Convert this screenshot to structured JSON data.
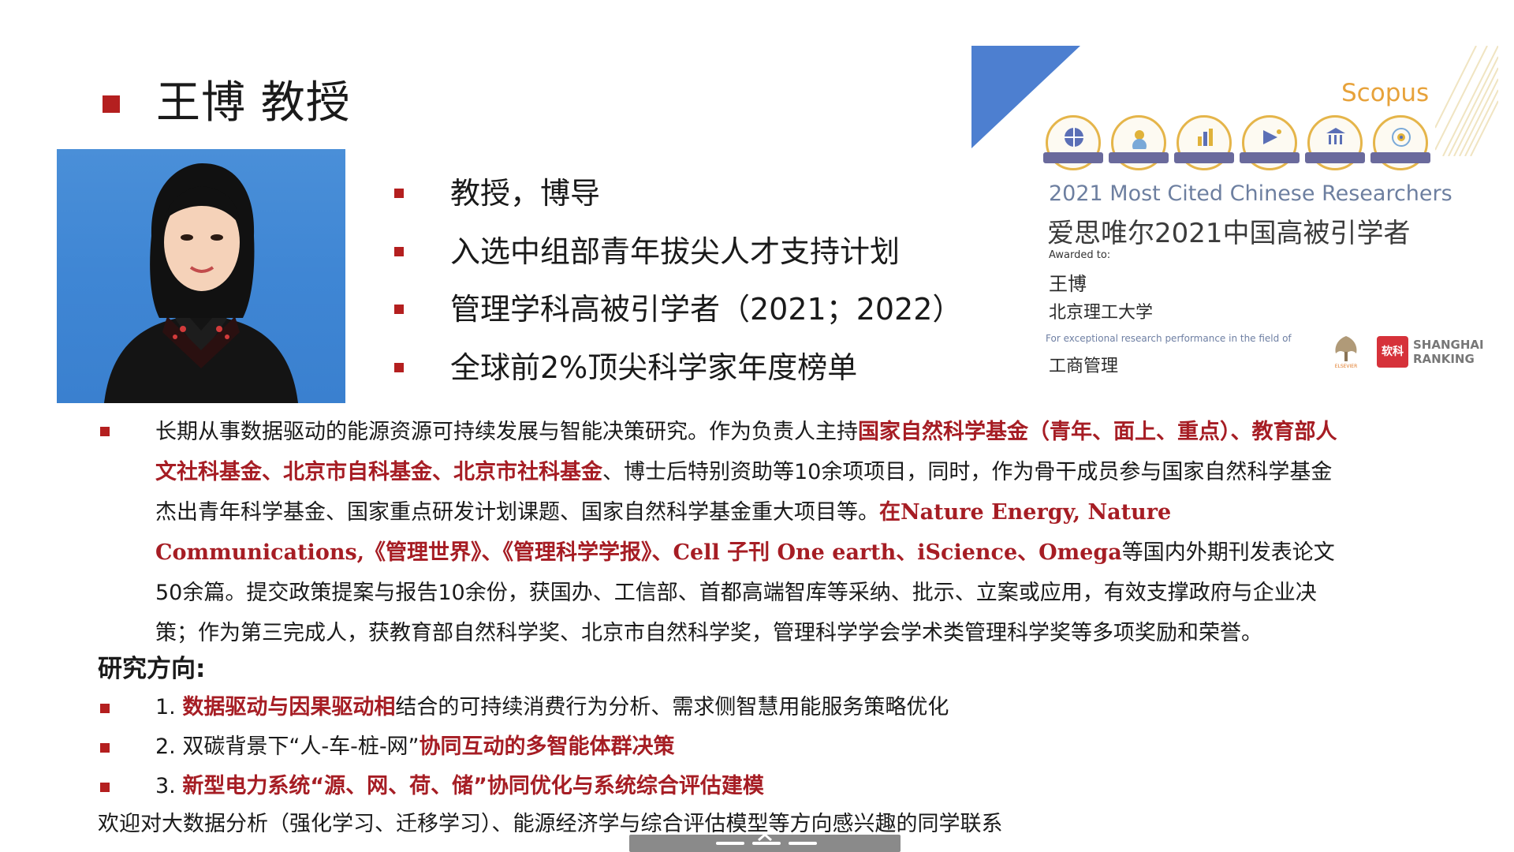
{
  "title": "王博 教授",
  "bullets": [
    "教授，博导",
    "入选中组部青年拔尖人才支持计划",
    "管理学科高被引学者（2021；2022）",
    "全球前2%顶尖科学家年度榜单"
  ],
  "paragraph": {
    "t1": "长期从事数据驱动的能源资源可持续发展与智能决策研究。作为负责人主持",
    "r1": "国家自然科学基金（青年、面上、重点）、教育部人文社科基金、北京市自科基金、北京市社科基金",
    "t2": "、博士后特别资助等10余项项目，同时，作为骨干成员参与国家自然科学基金杰出青年科学基金、国家重点研发计划课题、国家自然科学基金重大项目等。",
    "r2": "在Nature Energy, Nature Communications,《管理世界》、《管理科学学报》、Cell 子刊 One earth、iScience、Omega",
    "t3": "等国内外期刊发表论文50余篇。提交政策提案与报告10余份，获国办、工信部、首都高端智库等采纳、批示、立案或应用，有效支撑政府与企业决策；作为第三完成人，获教育部自然科学奖、北京市自然科学奖，管理科学学会学术类管理科学奖等多项奖励和荣誉。"
  },
  "research": {
    "heading": "研究方向:",
    "items": [
      {
        "prefix": "1. ",
        "red": "数据驱动与因果驱动相",
        "rest": "结合的可持续消费行为分析、需求侧智慧用能服务策略优化"
      },
      {
        "prefix": "2. 双碳背景下“人-车-桩-网”",
        "red": "协同互动的多智能体群决策",
        "rest": ""
      },
      {
        "prefix": "3. ",
        "red": "新型电力系统“源、网、荷、储”协同优化与系统综合评估建模",
        "rest": ""
      }
    ],
    "welcome": "欢迎对大数据分析（强化学习、迁移学习）、能源经济学与综合评估模型等方向感兴趣的同学联系"
  },
  "award": {
    "brand": "Scopus",
    "icons": [
      "topical-search",
      "author-identity",
      "metrics",
      "apis",
      "institutions",
      "user-outreach"
    ],
    "en_title": "2021 Most Cited Chinese Researchers",
    "cn_title": "爱思唯尔2021中国高被引学者",
    "awarded_to": "Awarded to:",
    "name": "王博",
    "university": "北京理工大学",
    "field_note": "For exceptional research performance in the field of",
    "field": "工商管理",
    "logo_elsevier": "ELSEVIER",
    "logo_sr_cn": "软科",
    "logo_sr_en_1": "SHANGHAI",
    "logo_sr_en_2": "RANKING"
  },
  "colors": {
    "accent": "#b41f1f",
    "highlight": "#a61d24",
    "badge_blue": "#4d7fd0",
    "scopus_orange": "#e7a23a"
  }
}
